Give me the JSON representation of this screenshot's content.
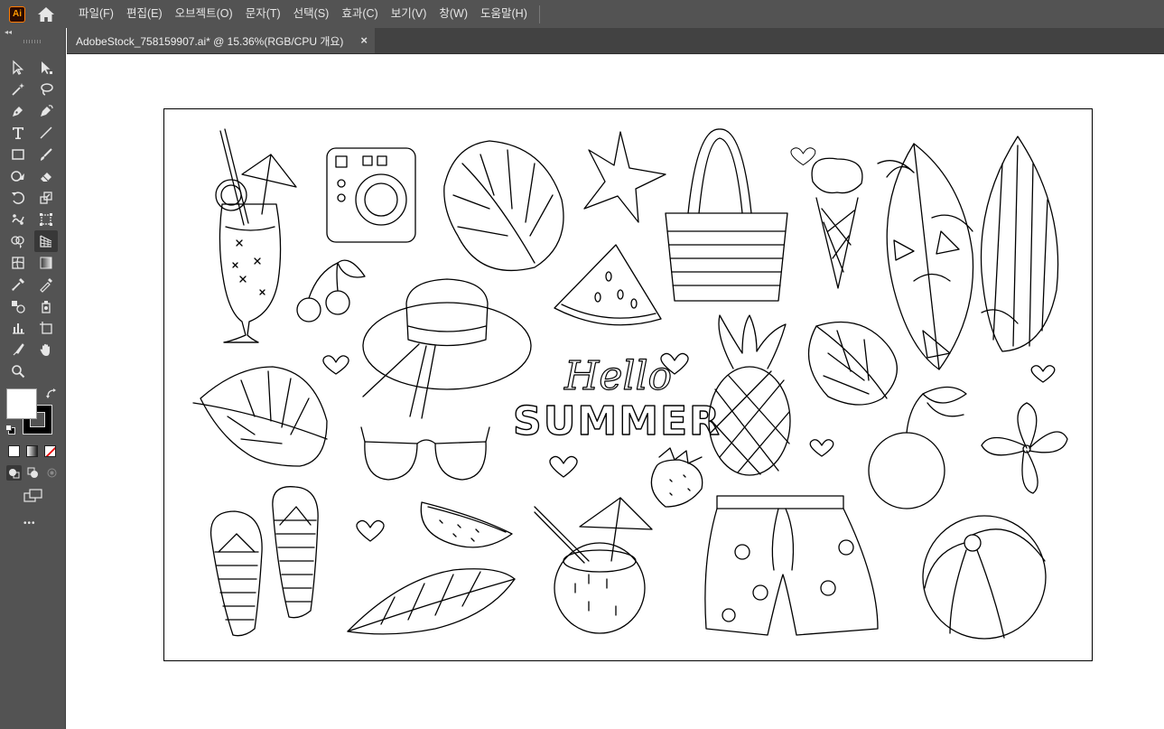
{
  "app": {
    "logo": "Ai",
    "home_icon": "home-icon"
  },
  "menu": [
    {
      "label": "파일(F)"
    },
    {
      "label": "편집(E)"
    },
    {
      "label": "오브젝트(O)"
    },
    {
      "label": "문자(T)"
    },
    {
      "label": "선택(S)"
    },
    {
      "label": "효과(C)"
    },
    {
      "label": "보기(V)"
    },
    {
      "label": "창(W)"
    },
    {
      "label": "도움말(H)"
    }
  ],
  "toolbar": {
    "collapse": "◂◂",
    "more": "•••"
  },
  "document": {
    "tab_title": "AdobeStock_758159907.ai*  @  15.36%(RGB/CPU 개요)",
    "close_icon": "×"
  },
  "artwork": {
    "hello": "Hello",
    "summer": "SUMMER"
  },
  "colors": {
    "chrome": "#535353",
    "tabbar": "#424242",
    "active_tool": "#383838",
    "logo_accent": "#ff9a00"
  }
}
